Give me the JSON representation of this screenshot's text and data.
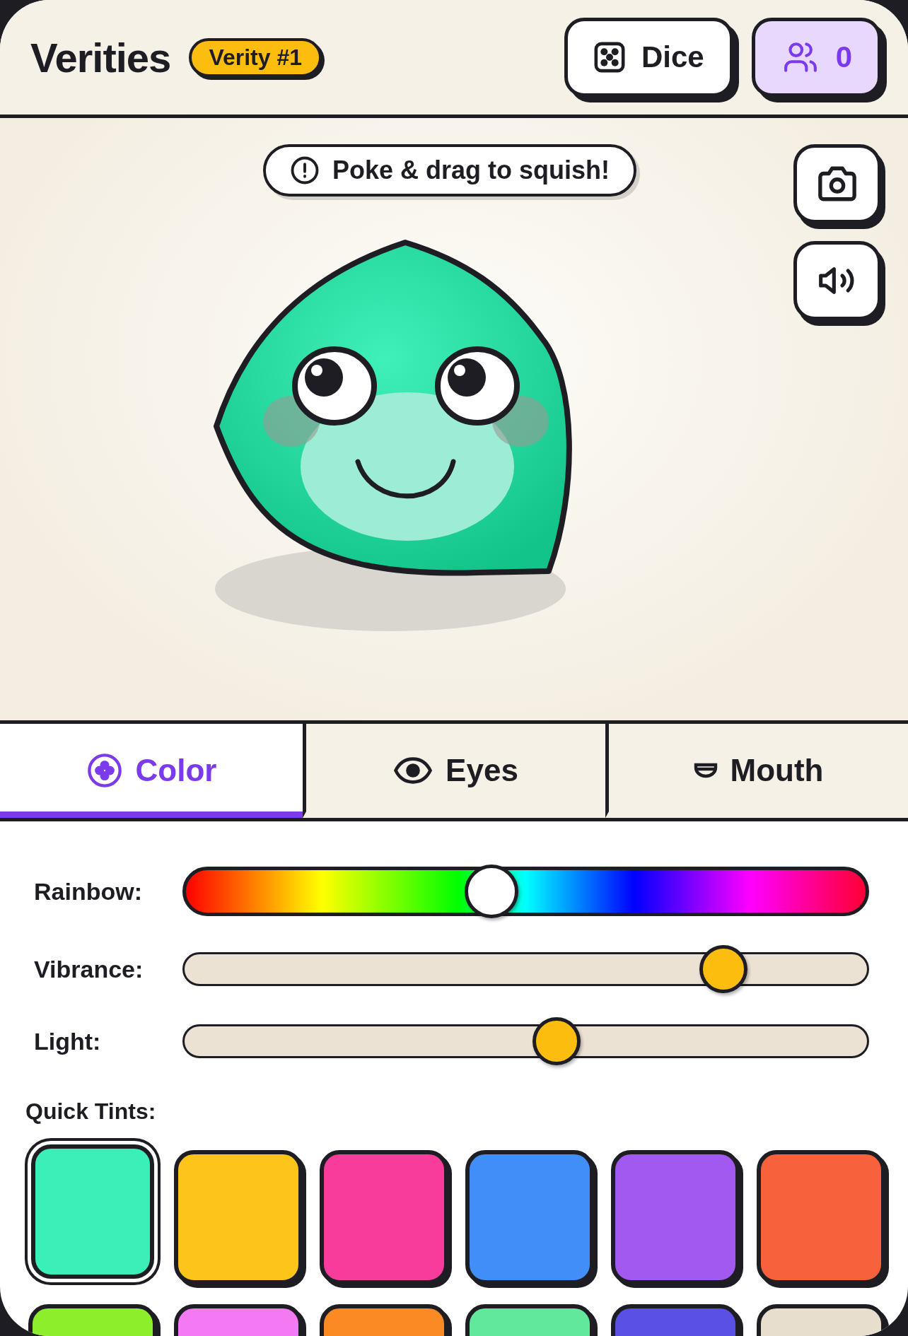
{
  "header": {
    "title": "Verities",
    "badge": "Verity #1",
    "dice_button": "Dice",
    "players_button": "0"
  },
  "stage": {
    "hint": "Poke & drag to squish!"
  },
  "tabs": [
    {
      "kind": "color",
      "label": "Color",
      "selected": true
    },
    {
      "kind": "eyes",
      "label": "Eyes",
      "selected": false
    },
    {
      "kind": "mouth",
      "label": "Mouth",
      "selected": false
    }
  ],
  "sliders": [
    {
      "kind": "rainbow",
      "label": "Rainbow:",
      "level": 0.45
    },
    {
      "kind": "plain",
      "label": "Vibrance:",
      "level": 0.79
    },
    {
      "kind": "plain",
      "label": "Light:",
      "level": 0.545
    }
  ],
  "quick_tints": {
    "label": "Quick Tints:",
    "swatches": [
      {
        "color": "#3bf0b8",
        "selected": true
      },
      {
        "color": "#fdc419",
        "selected": false
      },
      {
        "color": "#f83c9b",
        "selected": false
      },
      {
        "color": "#428ef9",
        "selected": false
      },
      {
        "color": "#a259f0",
        "selected": false
      },
      {
        "color": "#f7623d",
        "selected": false
      },
      {
        "color": "#8def2b",
        "selected": false
      },
      {
        "color": "#f47af4",
        "selected": false
      },
      {
        "color": "#fb8a24",
        "selected": false
      },
      {
        "color": "#62e89c",
        "selected": false
      },
      {
        "color": "#5b50e6",
        "selected": false
      },
      {
        "color": "#e8decd",
        "selected": false
      }
    ]
  }
}
